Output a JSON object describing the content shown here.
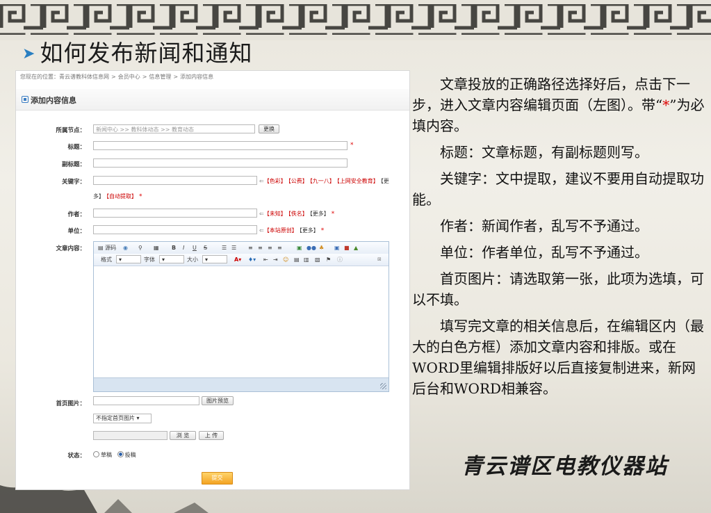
{
  "slide": {
    "title": "如何发布新闻和通知",
    "footer": "青云谱区电教仪器站"
  },
  "breadcrumb": {
    "prefix": "您现在的位置：",
    "items": [
      "青云谱教科体信息网",
      "会员中心",
      "信息管理",
      "添加内容信息"
    ]
  },
  "form": {
    "section_title": "添加内容信息",
    "node_label": "所属节点：",
    "node_value": "新闻中心 >> 教科体动态 >> 教育动态",
    "change_button": "更换",
    "title_label": "标题：",
    "subtitle_label": "副标题：",
    "keywords_label": "关键字：",
    "keyword_tags": [
      "【色彩】",
      "【公费】",
      "【九一八】",
      "【上网安全教育】",
      "【更"
    ],
    "keyword_tags2": [
      "多】",
      "【自动提取】"
    ],
    "author_label": "作者：",
    "author_tags": [
      "【未知】",
      "【佚名】",
      "【更多】"
    ],
    "unit_label": "单位：",
    "unit_tags": [
      "【本站原创】",
      "【更多】"
    ],
    "content_label": "文章内容：",
    "toolbar1": [
      "源码"
    ],
    "toolbar2": {
      "format": "格式",
      "font": "字体",
      "size": "大小"
    },
    "image_label": "首页图片：",
    "preview_button": "图片预览",
    "image_select": "不指定首页图片",
    "browse_button": "浏 览",
    "upload_button": "上 传",
    "status_label": "状态：",
    "status_draft": "草稿",
    "status_submit": "投稿",
    "submit_button": "提交",
    "required_mark": "*"
  },
  "description": {
    "p1_a": "文章投放的正确路径选择好后，点击下一步，进入文章内容编辑页面（左图）。带“",
    "p1_star": "*",
    "p1_b": "”为必填内容。",
    "p2": "标题：文章标题，有副标题则写。",
    "p3": "关键字：文中提取，建议不要用自动提取功能。",
    "p4": "作者：新闻作者，乱写不予通过。",
    "p5": "单位：作者单位，乱写不予通过。",
    "p6": "首页图片：请选取第一张，此项为选填，可以不填。",
    "p7": "填写完文章的相关信息后，在编辑区内（最大的白色方框）添加文章内容和排版。或在WORD里编辑排版好以后直接复制进来，新网后台和WORD相兼容。"
  },
  "colors": {
    "required": "#dd0000",
    "accent": "#3a7dc4",
    "submit": "#f3a424"
  }
}
